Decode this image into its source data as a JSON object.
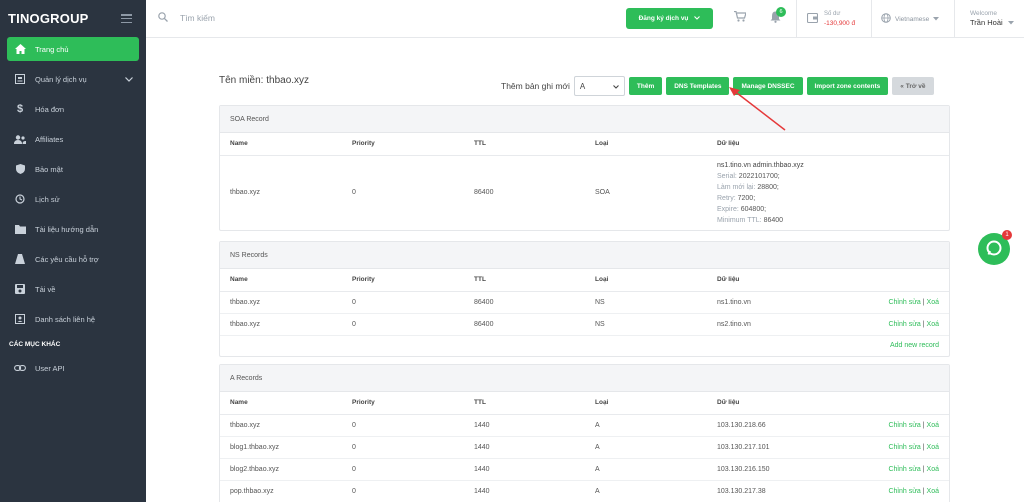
{
  "sidebar": {
    "logo": "TINOGROUP",
    "items": [
      {
        "label": "Trang chủ",
        "icon": "home-icon",
        "active": true
      },
      {
        "label": "Quản lý dịch vụ",
        "icon": "server-icon",
        "has_chevron": true
      },
      {
        "label": "Hóa đơn",
        "icon": "dollar-icon"
      },
      {
        "label": "Affiliates",
        "icon": "users-icon"
      },
      {
        "label": "Bảo mật",
        "icon": "shield-icon"
      },
      {
        "label": "Lịch sử",
        "icon": "history-icon"
      },
      {
        "label": "Tài liệu hướng dẫn",
        "icon": "folder-icon"
      },
      {
        "label": "Các yêu cầu hỗ trợ",
        "icon": "ticket-icon"
      },
      {
        "label": "Tải về",
        "icon": "save-icon"
      },
      {
        "label": "Danh sách liên hệ",
        "icon": "contacts-icon"
      }
    ],
    "section_title": "CÁC MỤC KHÁC",
    "extra_items": [
      {
        "label": "User API",
        "icon": "link-icon"
      }
    ]
  },
  "topbar": {
    "search_placeholder": "Tìm kiếm",
    "register_label": "Đăng ký dịch vụ",
    "notification_count": "6",
    "balance_label": "Số dư",
    "balance_value": "-130,900 đ",
    "language": "Vietnamese",
    "welcome": "Welcome",
    "user_name": "Trần Hoài"
  },
  "page": {
    "domain_title": "Tên miền: thbao.xyz",
    "add_label": "Thêm bản ghi mới",
    "record_type": "A",
    "buttons": {
      "add": "Thêm",
      "templates": "DNS Templates",
      "dnssec": "Manage DNSSEC",
      "import": "Import zone contents",
      "back": "« Trở về"
    }
  },
  "columns": {
    "name": "Name",
    "priority": "Priority",
    "ttl": "TTL",
    "type": "Loại",
    "data": "Dữ liệu"
  },
  "soa": {
    "title": "SOA Record",
    "name": "thbao.xyz",
    "priority": "0",
    "ttl": "86400",
    "type": "SOA",
    "data_main": "ns1.tino.vn admin.thbao.xyz",
    "serial_label": "Serial:",
    "serial": "2022101700;",
    "refresh_label": "Làm mới lại:",
    "refresh": "28800;",
    "retry_label": "Retry:",
    "retry": "7200;",
    "expire_label": "Expire:",
    "expire": "604800;",
    "min_ttl_label": "Minimum TTL:",
    "min_ttl": "86400"
  },
  "ns": {
    "title": "NS Records",
    "rows": [
      {
        "name": "thbao.xyz",
        "priority": "0",
        "ttl": "86400",
        "type": "NS",
        "data": "ns1.tino.vn"
      },
      {
        "name": "thbao.xyz",
        "priority": "0",
        "ttl": "86400",
        "type": "NS",
        "data": "ns2.tino.vn"
      }
    ],
    "add_new": "Add new record"
  },
  "a": {
    "title": "A Records",
    "rows": [
      {
        "name": "thbao.xyz",
        "priority": "0",
        "ttl": "1440",
        "type": "A",
        "data": "103.130.218.66"
      },
      {
        "name": "blog1.thbao.xyz",
        "priority": "0",
        "ttl": "1440",
        "type": "A",
        "data": "103.130.217.101"
      },
      {
        "name": "blog2.thbao.xyz",
        "priority": "0",
        "ttl": "1440",
        "type": "A",
        "data": "103.130.216.150"
      },
      {
        "name": "pop.thbao.xyz",
        "priority": "0",
        "ttl": "1440",
        "type": "A",
        "data": "103.130.217.38"
      }
    ]
  },
  "row_actions": {
    "edit": "Chỉnh sửa",
    "separator": "|",
    "delete": "Xoá"
  },
  "chat": {
    "badge": "1"
  },
  "colors": {
    "accent": "#2ebd59",
    "sidebar": "#2b3440",
    "danger": "#e5393a"
  }
}
